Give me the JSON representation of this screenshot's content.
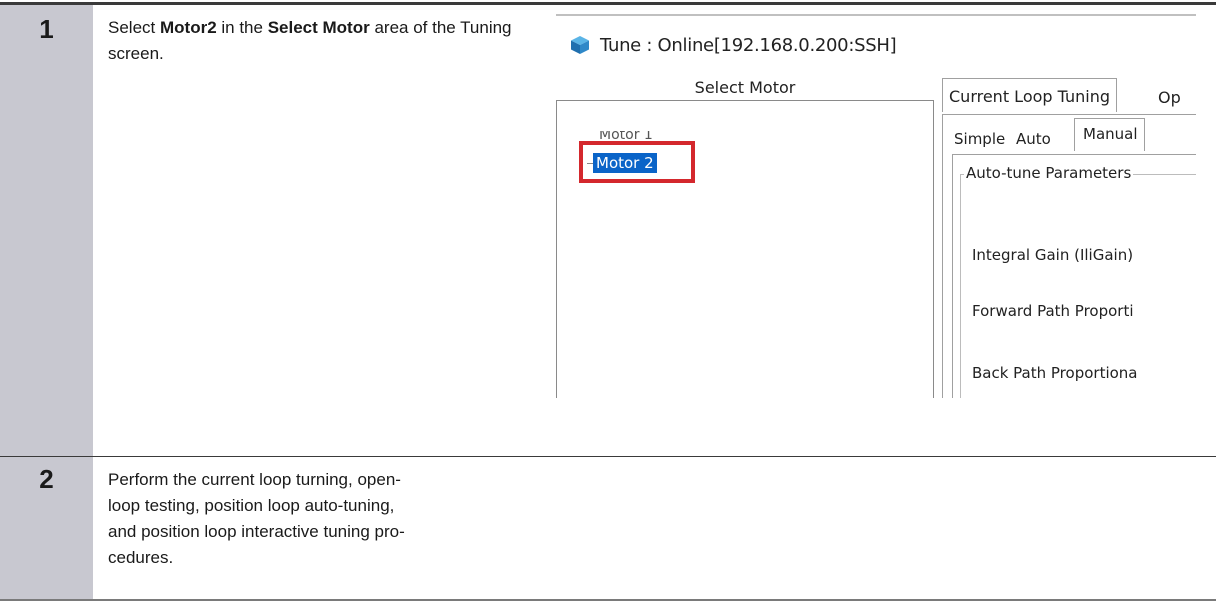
{
  "steps": [
    {
      "number": "1",
      "text_parts": [
        "Select ",
        "Motor2",
        " in the ",
        "Select Motor",
        " area of the Tuning screen."
      ]
    },
    {
      "number": "2",
      "text": "Perform the current loop turning, open-loop testing, position loop auto-tuning, and position loop interactive tuning procedures.",
      "lines": [
        "Perform the current loop turning, open-",
        "loop testing, position loop auto-tuning,",
        "and position loop interactive tuning pro-",
        "cedures."
      ]
    }
  ],
  "screenshot": {
    "window_title": "Tune : Online[192.168.0.200:SSH]",
    "title_icon": "cube-icon",
    "select_motor_header": "Select Motor",
    "tree_items": [
      "Motor 1",
      "Motor 2"
    ],
    "selected_item": "Motor 2",
    "highlight_color": "#d4282d",
    "tabs": [
      "Current Loop Tuning",
      "Op"
    ],
    "sub_tabs": [
      "Simple",
      "Auto",
      "Manual"
    ],
    "group_label": "Auto-tune Parameters",
    "params": [
      "Integral Gain (IliGain)",
      "Forward Path Proporti",
      "Back Path Proportiona"
    ]
  }
}
